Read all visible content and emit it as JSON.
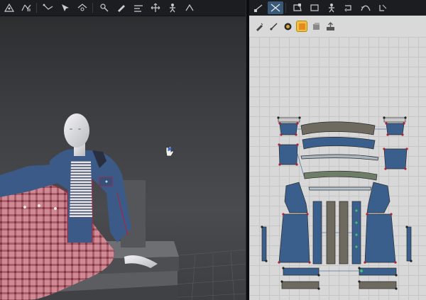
{
  "window": {
    "title": ""
  },
  "toolbar3d": {
    "tools": [
      {
        "name": "grid-select-icon"
      },
      {
        "name": "tack-icon"
      },
      {
        "name": "line-tool-icon"
      },
      {
        "name": "select-mesh-icon"
      },
      {
        "name": "fold-tool-icon"
      },
      {
        "name": "pin-tool-icon"
      },
      {
        "name": "brush-tool-icon"
      },
      {
        "name": "measure-icon"
      },
      {
        "name": "move-icon"
      },
      {
        "name": "avatar-pose-icon"
      },
      {
        "name": "extra-tool-icon"
      }
    ]
  },
  "toolbar2d": {
    "tools": [
      {
        "name": "transform-pattern-icon",
        "active": false
      },
      {
        "name": "edit-pattern-icon",
        "active": true
      },
      {
        "name": "polygon-icon",
        "active": false
      },
      {
        "name": "rectangle-icon",
        "active": false
      },
      {
        "name": "segment-sewing-icon",
        "active": false
      },
      {
        "name": "free-sewing-icon",
        "active": false
      },
      {
        "name": "curve-point-icon",
        "active": false
      },
      {
        "name": "internal-line-icon",
        "active": false
      }
    ]
  },
  "subtoolbar2d": {
    "tools": [
      {
        "name": "brush-icon",
        "active": false
      },
      {
        "name": "stitch-icon",
        "active": false
      },
      {
        "name": "fabric-icon",
        "active": false
      },
      {
        "name": "texture-icon",
        "active": true
      },
      {
        "name": "layer-icon",
        "active": false
      },
      {
        "name": "export-icon",
        "active": false
      }
    ]
  },
  "colors": {
    "pattern_fill": "#3b5f8c",
    "plaid": "#b86a78",
    "denim": "#3b5a88",
    "sewing_line": "#b0203a",
    "grid_bg": "#d8d8d8"
  }
}
